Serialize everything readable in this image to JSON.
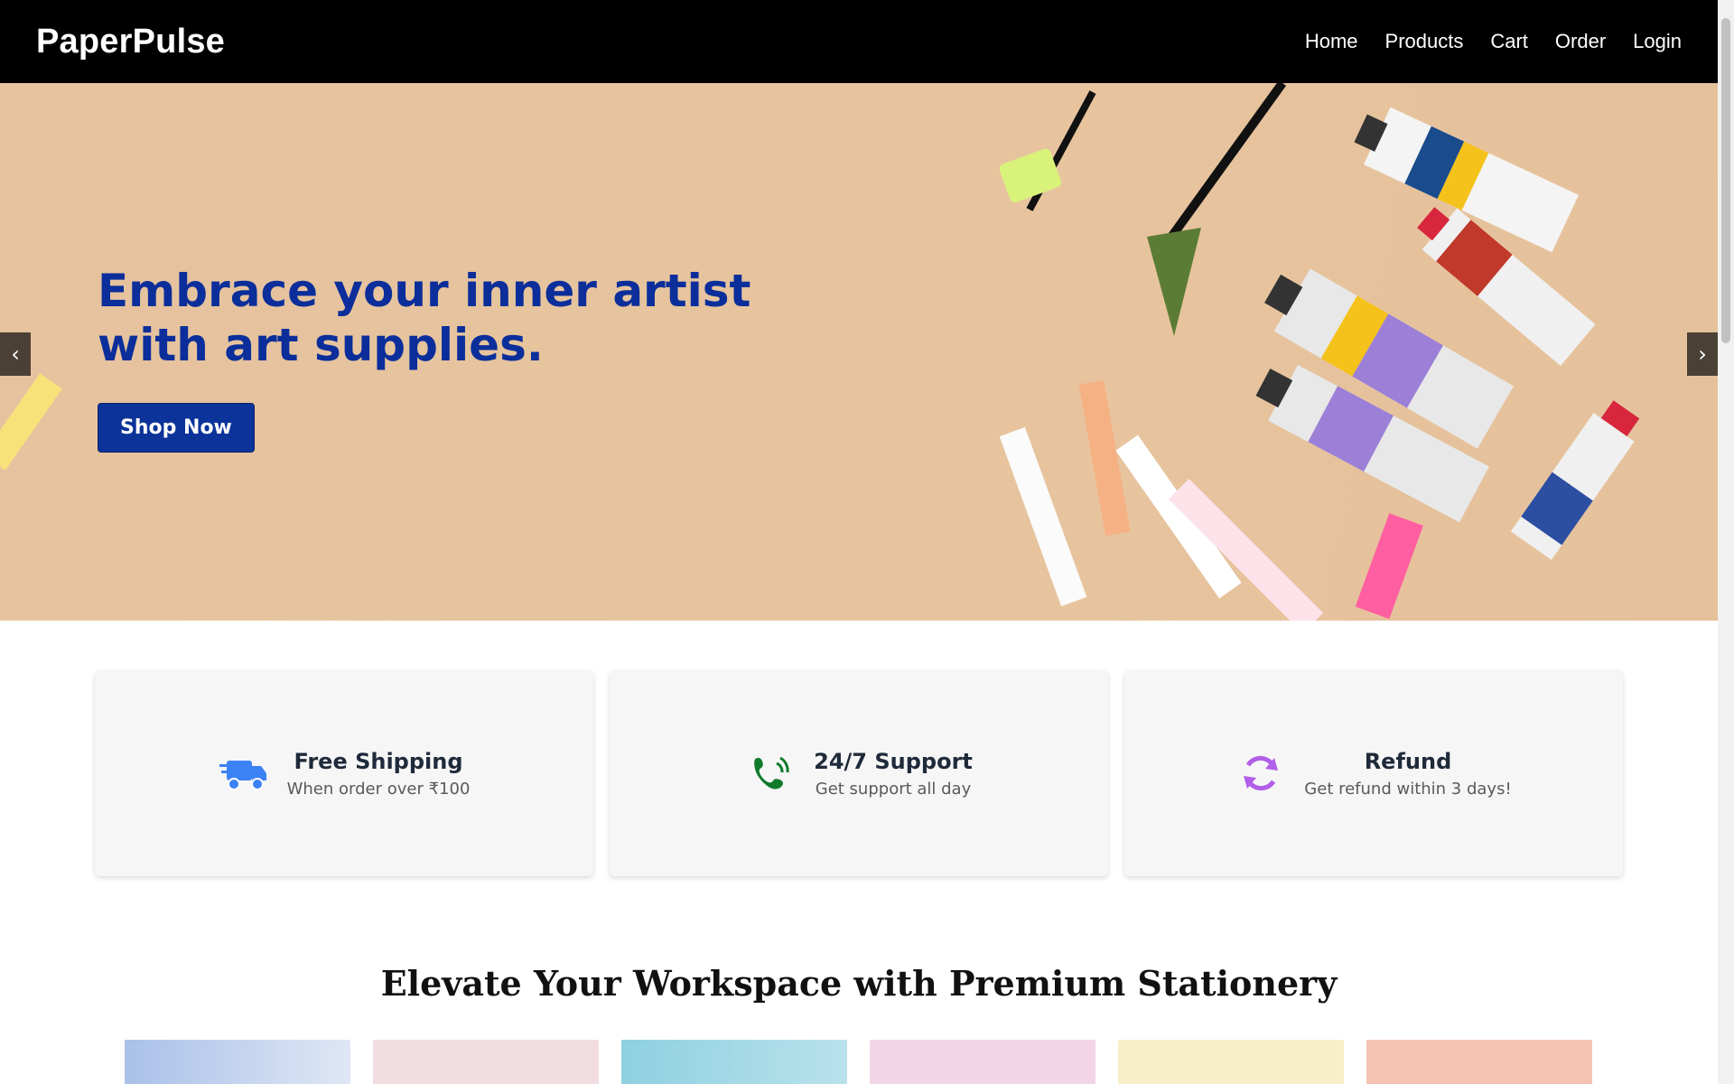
{
  "nav": {
    "brand": "PaperPulse",
    "links": [
      "Home",
      "Products",
      "Cart",
      "Order",
      "Login"
    ]
  },
  "hero": {
    "title_line1": "Embrace your inner artist",
    "title_line2": "with art supplies.",
    "button": "Shop Now",
    "prev": "‹",
    "next": "›"
  },
  "features": [
    {
      "icon": "truck-icon",
      "title": "Free Shipping",
      "subtitle": "When order over ₹100",
      "color": "#3b82f6"
    },
    {
      "icon": "phone-icon",
      "title": "24/7 Support",
      "subtitle": "Get support all day",
      "color": "#0f7a2a"
    },
    {
      "icon": "refresh-icon",
      "title": "Refund",
      "subtitle": "Get refund within 3 days!",
      "color": "#b15ee8"
    }
  ],
  "section": {
    "title": "Elevate Your Workspace with Premium Stationery"
  },
  "colors": {
    "nav_bg": "#000000",
    "hero_bg": "#e6c39e",
    "accent": "#0b3399"
  }
}
